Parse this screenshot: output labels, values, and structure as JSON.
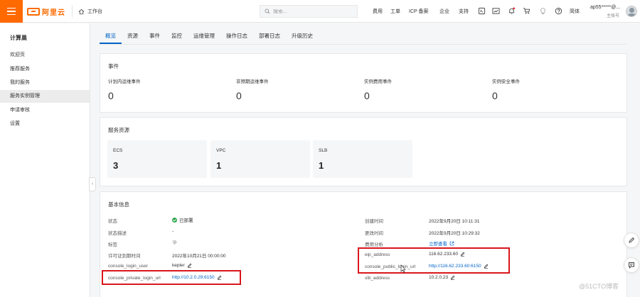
{
  "topbar": {
    "brand": "阿里云",
    "workbench": "工作台",
    "search_placeholder": "搜索...",
    "links": [
      "费用",
      "工单",
      "ICP 备案",
      "企业",
      "支持"
    ],
    "lang": "简体",
    "user_name": "ap55*****@...",
    "user_sub": "主账号"
  },
  "sidebar": {
    "title": "计算巢",
    "items": [
      {
        "label": "欢迎页"
      },
      {
        "label": "推荐服务"
      },
      {
        "label": "我的服务"
      },
      {
        "label": "服务实例管理"
      },
      {
        "label": "申请审核"
      },
      {
        "label": "设置"
      }
    ]
  },
  "tabs": [
    "概览",
    "资源",
    "事件",
    "监控",
    "运维管理",
    "操作日志",
    "部署日志",
    "升级历史"
  ],
  "events": {
    "title": "事件",
    "items": [
      {
        "label": "计划内运维事件",
        "value": "0"
      },
      {
        "label": "非预期运维事件",
        "value": "0"
      },
      {
        "label": "实例费用事件",
        "value": "0"
      },
      {
        "label": "实例安全事件",
        "value": "0"
      }
    ]
  },
  "resources": {
    "title": "服务资源",
    "items": [
      {
        "name": "ECS",
        "count": "3"
      },
      {
        "name": "VPC",
        "count": "1"
      },
      {
        "name": "SLB",
        "count": "1"
      }
    ]
  },
  "basic_info": {
    "title": "基本信息",
    "left": [
      {
        "key": "状态",
        "value": "已部署"
      },
      {
        "key": "状态描述",
        "value": "-"
      },
      {
        "key": "标签",
        "value": ""
      },
      {
        "key": "许可证到期时间",
        "value": "2022年10月21日 00:00:00"
      },
      {
        "key": "console_login_user",
        "value": "kepler"
      },
      {
        "key": "console_private_login_url",
        "value": "http://10.2.0.29:6150"
      }
    ],
    "right": [
      {
        "key": "创建时间",
        "value": "2022年9月20日 10:11:31"
      },
      {
        "key": "更改时间",
        "value": "2022年9月20日 10:29:32"
      },
      {
        "key": "费用分析",
        "value": "立即查看"
      },
      {
        "key": "eip_address",
        "value": "116.62.233.60"
      },
      {
        "key": "console_public_login_url",
        "value": "http://116.62.233.60:6150"
      },
      {
        "key": "slb_address",
        "value": "10.2.0.23"
      }
    ]
  },
  "watermark": "@51CTO博客",
  "colors": {
    "brand": "#ff6a00",
    "link": "#0064c8",
    "highlight": "#d9161c",
    "success": "#2aa44a"
  }
}
